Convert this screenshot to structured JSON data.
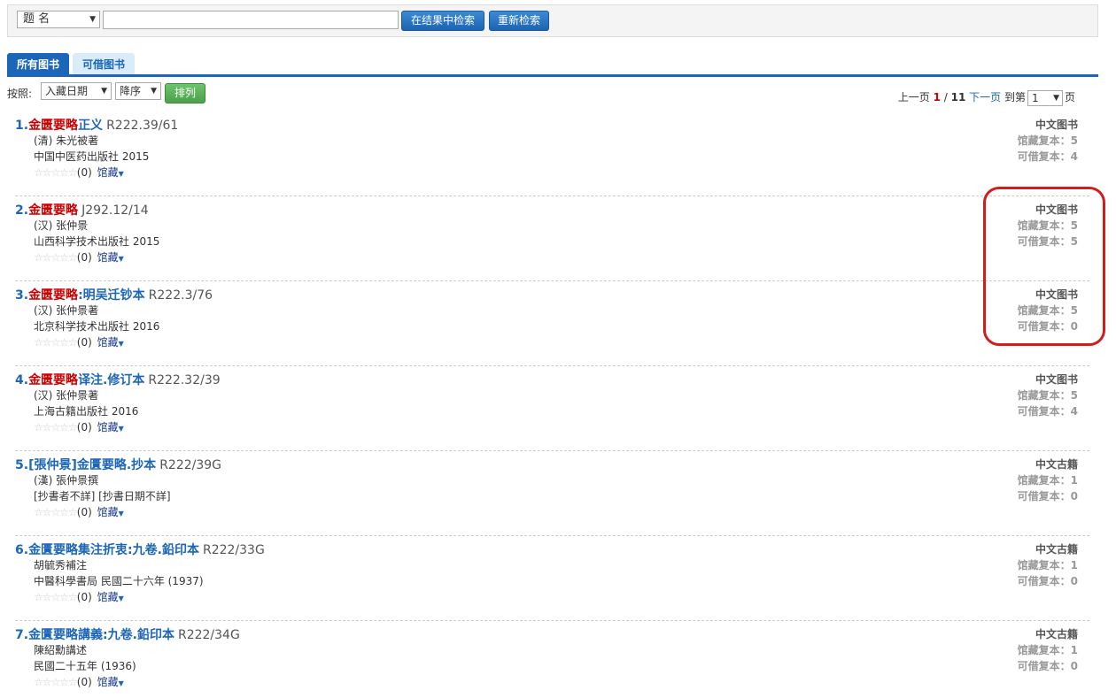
{
  "search": {
    "field_value": "题  名",
    "input_value": "",
    "filter_button": "在结果中检索",
    "reset_button": "重新检索"
  },
  "tabs": [
    {
      "label": "所有图书",
      "active": true
    },
    {
      "label": "可借图书",
      "active": false
    }
  ],
  "sort": {
    "label": "按照:",
    "field_value": "入藏日期",
    "order_value": "降序",
    "button": "排列"
  },
  "pager": {
    "prev": "上一页",
    "current": "1",
    "sep": " / ",
    "total": "11",
    "next": "下一页",
    "goto_prefix": "到第",
    "page_value": "1",
    "goto_suffix": "页"
  },
  "results": [
    {
      "num": "1.",
      "hl": "金匮要略",
      "rest": "正义",
      "call": "R222.39/61",
      "author": "(清) 朱光被著",
      "publisher": "中国中医药出版社 2015",
      "stars": "☆☆☆☆☆",
      "rating": "(0)",
      "holdings": "馆藏",
      "type": "中文图书",
      "total_copies": "馆藏复本：5",
      "avail_copies": "可借复本：4"
    },
    {
      "num": "2.",
      "hl": "金匮要略",
      "rest": "",
      "call": "J292.12/14",
      "author": "(汉) 张仲景",
      "publisher": "山西科学技术出版社 2015",
      "stars": "☆☆☆☆☆",
      "rating": "(0)",
      "holdings": "馆藏",
      "type": "中文图书",
      "total_copies": "馆藏复本：5",
      "avail_copies": "可借复本：5"
    },
    {
      "num": "3.",
      "hl": "金匮要略",
      "rest": ":明吴迁钞本",
      "call": "R222.3/76",
      "author": "(汉) 张仲景著",
      "publisher": "北京科学技术出版社 2016",
      "stars": "☆☆☆☆☆",
      "rating": "(0)",
      "holdings": "馆藏",
      "type": "中文图书",
      "total_copies": "馆藏复本：5",
      "avail_copies": "可借复本：0"
    },
    {
      "num": "4.",
      "hl": "金匮要略",
      "rest": "译注.修订本",
      "call": "R222.32/39",
      "author": "(汉) 张仲景著",
      "publisher": "上海古籍出版社 2016",
      "stars": "☆☆☆☆☆",
      "rating": "(0)",
      "holdings": "馆藏",
      "type": "中文图书",
      "total_copies": "馆藏复本：5",
      "avail_copies": "可借复本：4"
    },
    {
      "num": "5.",
      "hl": "",
      "rest": "[張仲景]金匱要略.抄本",
      "call": "R222/39G",
      "author": "(漢) 張仲景撰",
      "publisher": "[抄書者不詳] [抄書日期不詳]",
      "stars": "☆☆☆☆☆",
      "rating": "(0)",
      "holdings": "馆藏",
      "type": "中文古籍",
      "total_copies": "馆藏复本：1",
      "avail_copies": "可借复本：0"
    },
    {
      "num": "6.",
      "hl": "",
      "rest": "金匱要略集注折衷:九卷.鉛印本",
      "call": "R222/33G",
      "author": "胡毓秀補注",
      "publisher": "中醫科學書局 民國二十六年 (1937)",
      "stars": "☆☆☆☆☆",
      "rating": "(0)",
      "holdings": "馆藏",
      "type": "中文古籍",
      "total_copies": "馆藏复本：1",
      "avail_copies": "可借复本：0"
    },
    {
      "num": "7.",
      "hl": "",
      "rest": "金匱要略講義:九卷.鉛印本",
      "call": "R222/34G",
      "author": "陳紹勳講述",
      "publisher": " 民國二十五年 (1936)",
      "stars": "☆☆☆☆☆",
      "rating": "(0)",
      "holdings": "馆藏",
      "type": "中文古籍",
      "total_copies": "馆藏复本：1",
      "avail_copies": "可借复本：0"
    }
  ],
  "colors": {
    "accent": "#1b66b8",
    "highlight": "#c00000",
    "annotation": "#d31c1c",
    "sort_button": "#4aa24a"
  }
}
